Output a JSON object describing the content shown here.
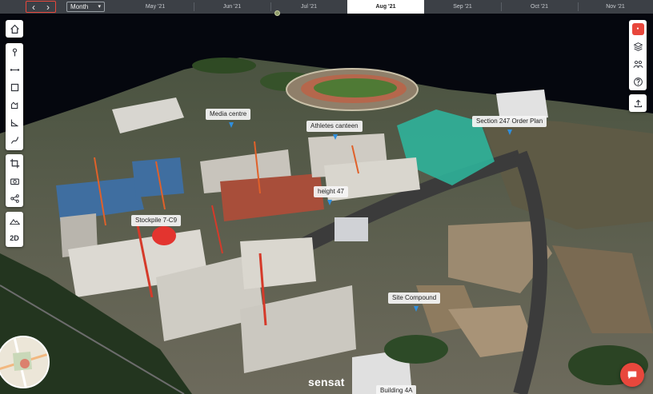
{
  "timeline": {
    "prev_icon": "chevron-left-icon",
    "next_icon": "chevron-right-icon",
    "period": "Month",
    "months": [
      "May '21",
      "Jun '21",
      "Jul '21",
      "Aug '21",
      "Sep '21",
      "Oct '21",
      "Nov '21"
    ],
    "active_month": "Aug '21"
  },
  "left_toolbar": {
    "home": "home-icon",
    "tools": [
      "pin-icon",
      "measure-line-icon",
      "area-icon",
      "volume-icon",
      "angle-icon",
      "path-icon"
    ],
    "tools2": [
      "crop-icon",
      "camera-icon",
      "share-icon"
    ],
    "tools3": [
      "terrain-icon"
    ],
    "view_mode": "2D"
  },
  "right_toolbar": {
    "logo": "sensat-logo-icon",
    "items": [
      "layers-icon",
      "users-icon",
      "help-icon"
    ],
    "upload": "upload-icon"
  },
  "labels": {
    "media_centre": "Media centre",
    "athletes_canteen": "Athletes canteen",
    "section_247": "Section 247 Order Plan",
    "height_47": "height 47",
    "stockpile": "Stockpile 7-C9",
    "site_compound": "Site Compound",
    "building_4a": "Building 4A"
  },
  "brand": "sensat",
  "colors": {
    "accent": "#e8473c",
    "pin": "#2f8fde",
    "highlight_green": "#2fb39a"
  }
}
